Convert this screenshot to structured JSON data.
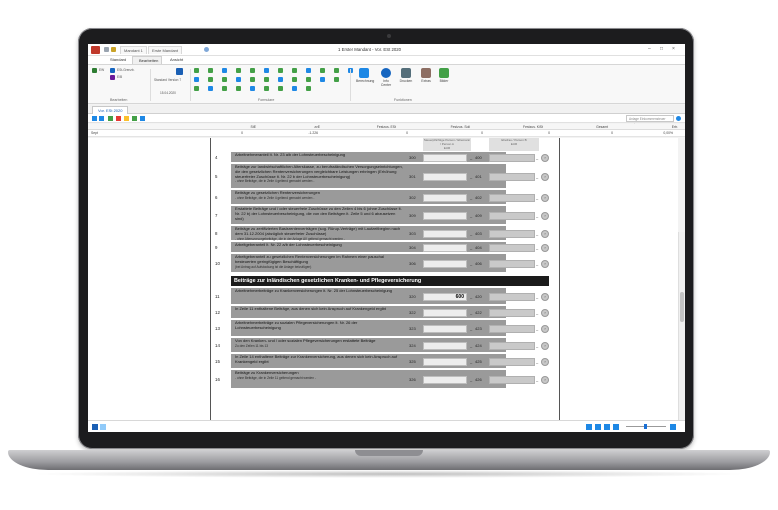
{
  "window": {
    "title": "1 Erster Mandant - Vor. ESt 2020",
    "doc_tabs": [
      "Mandant 1",
      "Erste Mandant"
    ]
  },
  "ribbon": {
    "tabs": [
      "Standard",
      "Bearbeiten",
      "Ansicht"
    ],
    "active_tab": "Bearbeiten",
    "groups": [
      {
        "label": "Bearbeiten"
      },
      {
        "label": "Formulare"
      },
      {
        "label": "Funktionen"
      }
    ],
    "left_buttons": [
      "EW",
      "ESt-Grenzb.",
      "E/B"
    ],
    "version_label": "Standard Version 7",
    "date_label": "15.04.2020",
    "big_buttons": [
      "Berechnung",
      "Info Center",
      "Drucken",
      "Extras",
      "Bilder"
    ]
  },
  "document_tab": {
    "label": "Vor. ESt 2020"
  },
  "toolbar": {
    "search_placeholder": "Anlage Einkommensteuer suchen"
  },
  "grid": {
    "headers": [
      "StE",
      "zvE",
      "Festzus. ESt",
      "Festzus. Soli",
      "Festzus. KiSt",
      "Gesamt",
      "Ertr."
    ],
    "row_label": "Sept",
    "values": [
      "0",
      "-1.226",
      "0",
      "0",
      "0",
      "0",
      "0,00%"
    ]
  },
  "form": {
    "col_header_left": "Steuerpflichtige Person / Ehemann / Person A",
    "col_header_left_unit": "EUR",
    "col_header_right": "Ehefrau / Person B",
    "col_header_right_unit": "EUR",
    "rows": [
      {
        "num": "4",
        "text": "Arbeitnehmeranteil lt. Nr. 23 a/b der Lohnsteuerbescheinigung",
        "sub": "",
        "code1": "300",
        "value": "",
        "code2": "400"
      },
      {
        "num": "5",
        "text": "Beiträge zur landwirtschaftlichen Alterskasse, zu berufsständischen Versorgungseinrichtungen, die den gesetzlichen Rentenversicherungen vergleichbare Leistungen erbringen (Erhöhung steuerfreier Zuschüsse lt. Nr. 22 b der Lohnsteuerbescheinigung)",
        "sub": "- ohne Beiträge, die in Zeile 4 geltend gemacht werden -",
        "code1": "301",
        "value": "",
        "code2": "401"
      },
      {
        "num": "6",
        "text": "Beiträge zu gesetzlichen Rentenversicherungen",
        "sub": "- ohne Beiträge, die in Zeile 4 geltend gemacht werden -",
        "code1": "302",
        "value": "",
        "code2": "402"
      },
      {
        "num": "7",
        "text": "Erstattete Beiträge und / oder steuerfreie Zuschüsse zu den Zeilen 4 bis 6 (ohne Zuschüsse lt. Nr. 22 b) der Lohnsteuerbescheinigung, die von den Beiträgen lt. Zeile 5 und 6 abzusetzen sind)",
        "sub": "",
        "code1": "309",
        "value": "",
        "code2": "409"
      },
      {
        "num": "8",
        "text": "Beiträge zu zertifizierten Basisrentenverträgen (sog. Rürup-Verträge) mit Laufzeitbeginn nach dem 31.12.2004 (abzüglich steuerfreier Zuschüsse)",
        "sub": "- ohne Altersvorsorgebeiträge, die in der Anlage AV geltend gemacht werden -",
        "code1": "303",
        "value": "",
        "code2": "403"
      },
      {
        "num": "9",
        "text": "Arbeitgeberanteil lt. Nr. 22 a/b der Lohnsteuerbescheinigung",
        "sub": "",
        "code1": "304",
        "value": "",
        "code2": "404"
      },
      {
        "num": "10",
        "text": "Arbeitgeberanteil / -zuschuss lt. Nr. 22 a/b der Lohnsteuerbescheinigung",
        "sub": "",
        "code1": "306",
        "value": "",
        "code2": "406"
      }
    ],
    "row10_text": "Arbeitgeberanteil zu gesetzlichen Rentenversicherungen im Rahmen einer pauschal besteuerten geringfügigen Beschäftigung",
    "row10_sub": "(bei Antrag auf Aufstockung ist die Anlage beizufügen)",
    "section_title": "Beiträge zur inländischen gesetzlichen Kranken- und Pflegeversicherung",
    "rows2": [
      {
        "num": "11",
        "text": "Arbeitnehmerbeiträge zu Krankenversicherungen lt. Nr. 25 der Lohnsteuerbescheinigung",
        "sub": "",
        "code1": "320",
        "value": "600",
        "code2": "420"
      },
      {
        "num": "12",
        "text": "In Zeile 11 enthaltene Beiträge, aus denen sich kein Anspruch auf Krankengeld ergibt",
        "sub": "",
        "code1": "322",
        "value": "",
        "code2": "422"
      },
      {
        "num": "13",
        "text": "Arbeitnehmerbeiträge zu sozialen Pflegeversicherungen lt. Nr. 26 der Lohnsteuerbescheinigung",
        "sub": "",
        "code1": "323",
        "value": "",
        "code2": "423"
      },
      {
        "num": "14",
        "text": "Von den Kranken- und / oder sozialen Pflegeversicherungen erstattete Beiträge",
        "sub": "Zu den Zeilen 11 bis 13",
        "code1": "324",
        "value": "",
        "code2": "424"
      },
      {
        "num": "15",
        "text": "In Zeile 14 enthaltene Beiträge zur Krankenversicherung, aus denen sich kein Anspruch auf Krankengeld ergibt",
        "sub": "",
        "code1": "325",
        "value": "",
        "code2": "425"
      },
      {
        "num": "16",
        "text": "Beiträge zu Krankenversicherungen",
        "sub": "- ohne Beiträge, die in Zeile 11 geltend gemacht werden -",
        "code1": "326",
        "value": "",
        "code2": "426"
      }
    ],
    "dash": "–"
  },
  "colors": {
    "accent": "#1a6fd4",
    "section_bar": "#1b1b1b",
    "row_gray": "#9a9a9a"
  }
}
